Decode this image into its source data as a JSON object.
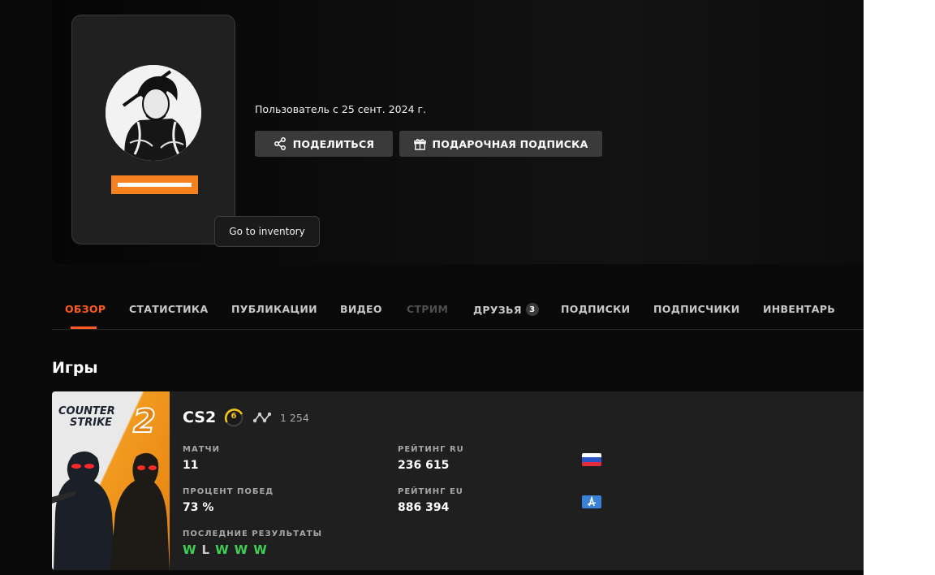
{
  "profile": {
    "member_since": "Пользователь с 25 сент. 2024 г.",
    "share_label": "ПОДЕЛИТЬСЯ",
    "gift_label": "ПОДАРОЧНАЯ ПОДПИСКА",
    "tooltip": "Go to inventory",
    "accent_color": "#f6821f"
  },
  "tabs": [
    {
      "label": "ОБЗОР",
      "state": "active"
    },
    {
      "label": "СТАТИСТИКА",
      "state": "normal"
    },
    {
      "label": "ПУБЛИКАЦИИ",
      "state": "normal"
    },
    {
      "label": "ВИДЕО",
      "state": "normal"
    },
    {
      "label": "СТРИМ",
      "state": "disabled"
    },
    {
      "label": "ДРУЗЬЯ",
      "state": "normal",
      "badge": "3"
    },
    {
      "label": "ПОДПИСКИ",
      "state": "normal"
    },
    {
      "label": "ПОДПИСЧИКИ",
      "state": "normal"
    },
    {
      "label": "ИНВЕНТАРЬ",
      "state": "normal"
    }
  ],
  "games_section": {
    "title": "Игры"
  },
  "game": {
    "cover_title_line1": "COUNTER",
    "cover_title_line2": "STRIKE",
    "cover_number": "2",
    "name": "CS2",
    "level": "6",
    "elo": "1 254",
    "matches_label": "МАТЧИ",
    "matches_value": "11",
    "winrate_label": "ПРОЦЕНТ ПОБЕД",
    "winrate_value": "73 %",
    "rating_ru_label": "РЕЙТИНГ RU",
    "rating_ru_value": "236 615",
    "rating_eu_label": "РЕЙТИНГ EU",
    "rating_eu_value": "886 394",
    "recent_label": "ПОСЛЕДНИЕ РЕЗУЛЬТАТЫ",
    "recent_results": [
      "W",
      "L",
      "W",
      "W",
      "W"
    ],
    "win_color": "#3fcf55",
    "level_color": "#f5c518"
  }
}
